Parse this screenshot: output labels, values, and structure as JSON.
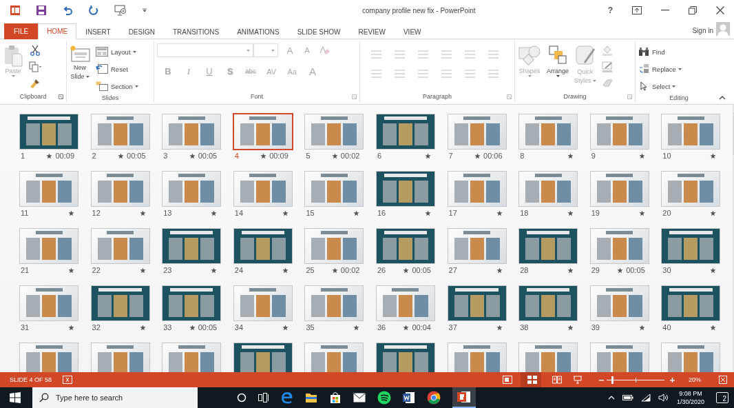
{
  "window": {
    "title": "company profile new fix - PowerPoint",
    "help": "?"
  },
  "tabs": [
    {
      "label": "FILE",
      "kind": "file",
      "selected": false
    },
    {
      "label": "HOME",
      "kind": "tab",
      "selected": true
    },
    {
      "label": "INSERT",
      "kind": "tab",
      "selected": false
    },
    {
      "label": "DESIGN",
      "kind": "tab",
      "selected": false
    },
    {
      "label": "TRANSITIONS",
      "kind": "tab",
      "selected": false
    },
    {
      "label": "ANIMATIONS",
      "kind": "tab",
      "selected": false
    },
    {
      "label": "SLIDE SHOW",
      "kind": "tab",
      "selected": false
    },
    {
      "label": "REVIEW",
      "kind": "tab",
      "selected": false
    },
    {
      "label": "VIEW",
      "kind": "tab",
      "selected": false
    }
  ],
  "sign_in": "Sign in",
  "ribbon": {
    "clipboard": {
      "label": "Clipboard",
      "paste": "Paste"
    },
    "slides": {
      "label": "Slides",
      "new_slide": [
        "New",
        "Slide"
      ],
      "layout": "Layout",
      "reset": "Reset",
      "section": "Section"
    },
    "font": {
      "label": "Font",
      "grow": "A",
      "shrink": "A",
      "buttons": [
        "B",
        "I",
        "U",
        "S",
        "abc",
        "AV",
        "Aa",
        "A"
      ]
    },
    "paragraph": {
      "label": "Paragraph"
    },
    "drawing": {
      "label": "Drawing",
      "shapes": "Shapes",
      "arrange": "Arrange",
      "quick_styles": [
        "Quick",
        "Styles"
      ]
    },
    "editing": {
      "label": "Editing",
      "find": "Find",
      "replace": "Replace",
      "select": "Select"
    }
  },
  "slides": [
    {
      "number": "1",
      "time": "00:09",
      "kind": "dark",
      "animated": true,
      "selected": false
    },
    {
      "number": "2",
      "time": "00:05",
      "kind": "light",
      "animated": true,
      "selected": false
    },
    {
      "number": "3",
      "time": "00:05",
      "kind": "light",
      "animated": true,
      "selected": false
    },
    {
      "number": "4",
      "time": "00:09",
      "kind": "light",
      "animated": true,
      "selected": true
    },
    {
      "number": "5",
      "time": "00:02",
      "kind": "light",
      "animated": true,
      "selected": false
    },
    {
      "number": "6",
      "kind": "dark",
      "animated": true,
      "selected": false
    },
    {
      "number": "7",
      "time": "00:06",
      "kind": "light",
      "animated": true,
      "selected": false
    },
    {
      "number": "8",
      "kind": "light",
      "animated": true,
      "selected": false
    },
    {
      "number": "9",
      "kind": "light",
      "animated": true,
      "selected": false
    },
    {
      "number": "10",
      "kind": "light",
      "animated": true,
      "selected": false
    },
    {
      "number": "11",
      "kind": "light",
      "animated": true,
      "selected": false
    },
    {
      "number": "12",
      "kind": "light",
      "animated": true,
      "selected": false
    },
    {
      "number": "13",
      "kind": "light",
      "animated": true,
      "selected": false
    },
    {
      "number": "14",
      "kind": "light",
      "animated": true,
      "selected": false
    },
    {
      "number": "15",
      "kind": "light",
      "animated": true,
      "selected": false
    },
    {
      "number": "16",
      "kind": "dark",
      "animated": true,
      "selected": false
    },
    {
      "number": "17",
      "kind": "light",
      "animated": true,
      "selected": false
    },
    {
      "number": "18",
      "kind": "light",
      "animated": true,
      "selected": false
    },
    {
      "number": "19",
      "kind": "light",
      "animated": true,
      "selected": false
    },
    {
      "number": "20",
      "kind": "light",
      "animated": true,
      "selected": false
    },
    {
      "number": "21",
      "kind": "light",
      "animated": true,
      "selected": false
    },
    {
      "number": "22",
      "kind": "light",
      "animated": true,
      "selected": false
    },
    {
      "number": "23",
      "kind": "dark",
      "animated": true,
      "selected": false
    },
    {
      "number": "24",
      "kind": "dark",
      "animated": true,
      "selected": false
    },
    {
      "number": "25",
      "time": "00:02",
      "kind": "light",
      "animated": true,
      "selected": false
    },
    {
      "number": "26",
      "time": "00:05",
      "kind": "dark",
      "animated": true,
      "selected": false
    },
    {
      "number": "27",
      "kind": "light",
      "animated": true,
      "selected": false
    },
    {
      "number": "28",
      "kind": "dark",
      "animated": true,
      "selected": false
    },
    {
      "number": "29",
      "time": "00:05",
      "kind": "light",
      "animated": true,
      "selected": false
    },
    {
      "number": "30",
      "kind": "dark",
      "animated": true,
      "selected": false
    },
    {
      "number": "31",
      "kind": "light",
      "animated": true,
      "selected": false
    },
    {
      "number": "32",
      "kind": "dark",
      "animated": true,
      "selected": false
    },
    {
      "number": "33",
      "time": "00:05",
      "kind": "dark",
      "animated": true,
      "selected": false
    },
    {
      "number": "34",
      "kind": "light",
      "animated": true,
      "selected": false
    },
    {
      "number": "35",
      "kind": "light",
      "animated": true,
      "selected": false
    },
    {
      "number": "36",
      "time": "00:04",
      "kind": "light",
      "animated": true,
      "selected": false
    },
    {
      "number": "37",
      "kind": "dark",
      "animated": true,
      "selected": false
    },
    {
      "number": "38",
      "kind": "dark",
      "animated": true,
      "selected": false
    },
    {
      "number": "39",
      "kind": "light",
      "animated": true,
      "selected": false
    },
    {
      "number": "40",
      "kind": "dark",
      "animated": true,
      "selected": false
    }
  ],
  "slides_cut_off": [
    {
      "kind": "light"
    },
    {
      "kind": "light"
    },
    {
      "kind": "light"
    },
    {
      "kind": "dark"
    },
    {
      "kind": "light"
    },
    {
      "kind": "dark"
    },
    {
      "kind": "light"
    },
    {
      "kind": "light"
    },
    {
      "kind": "light"
    },
    {
      "kind": "light"
    }
  ],
  "status_bar": {
    "slide_info": "SLIDE 4 OF 58",
    "zoom": "20%",
    "zoom_slider": {
      "level": 0.1
    }
  },
  "taskbar": {
    "search_placeholder": "Type here to search",
    "time": "9:08 PM",
    "date": "1/30/2020",
    "notifications": "2"
  }
}
